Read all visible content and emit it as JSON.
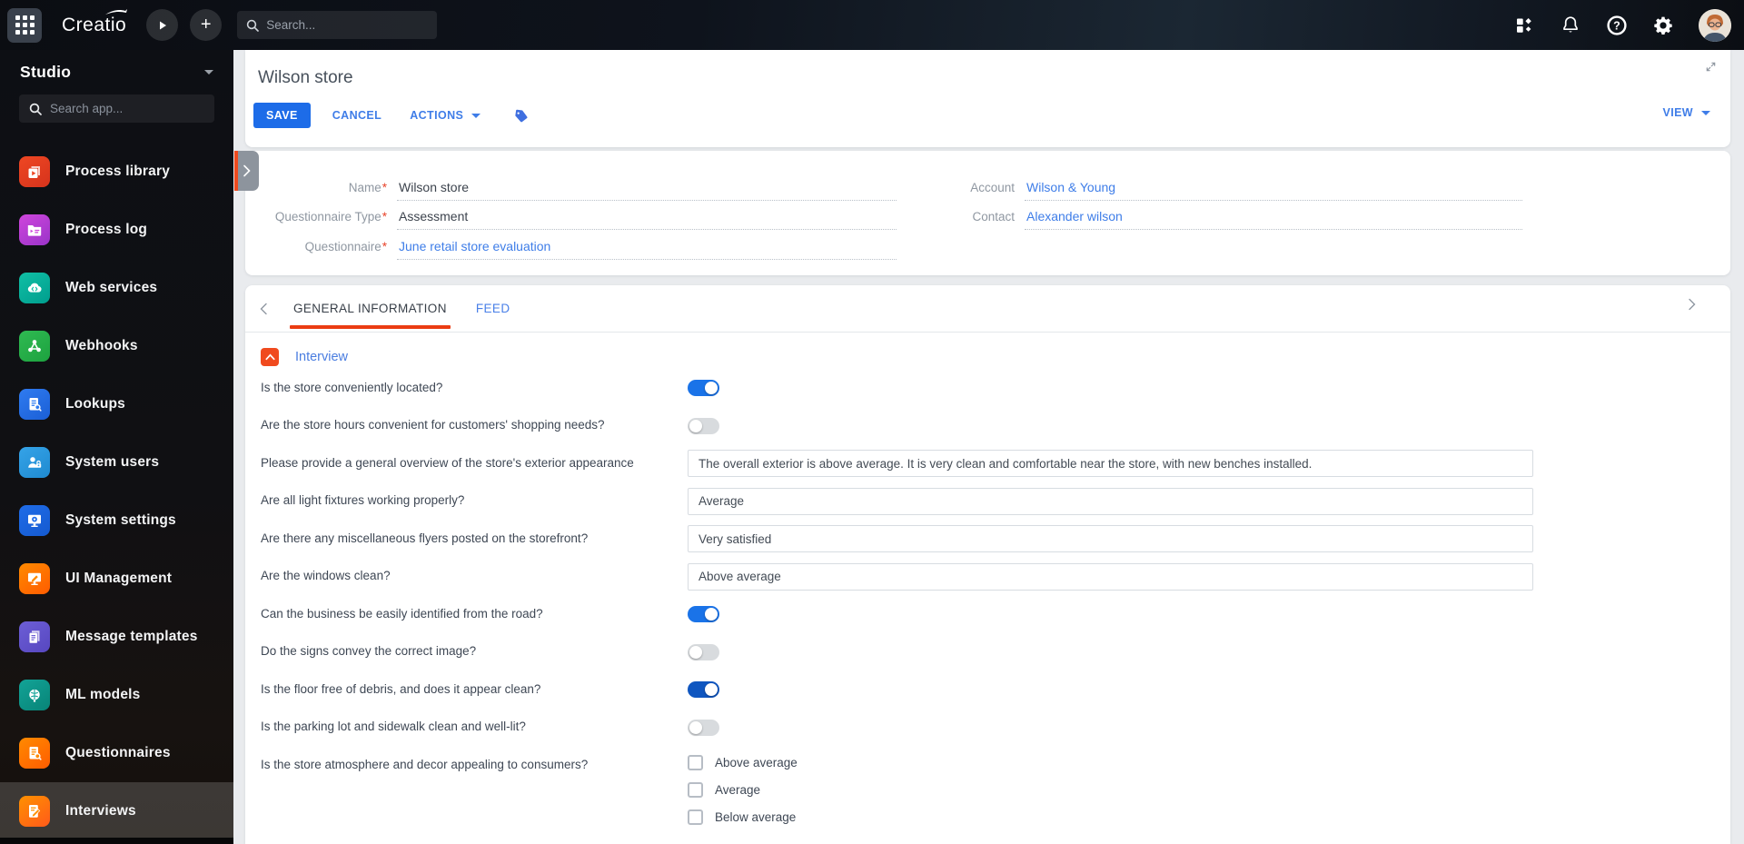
{
  "topbar": {
    "logo": "Creatio",
    "search_placeholder": "Search...",
    "right_icons": [
      "apps",
      "notifications",
      "help",
      "settings",
      "avatar"
    ]
  },
  "sidebar": {
    "workspace": "Studio",
    "search_placeholder": "Search app...",
    "items": [
      {
        "label": "Process library",
        "icon": "process-library",
        "tile": "#ee4723",
        "tile2": "#d6331c",
        "selected": false
      },
      {
        "label": "Process log",
        "icon": "process-log",
        "tile": "#cf46dc",
        "tile2": "#9a34c9",
        "selected": false
      },
      {
        "label": "Web services",
        "icon": "web-services",
        "tile": "#10bfa5",
        "tile2": "#009e8e",
        "selected": false
      },
      {
        "label": "Webhooks",
        "icon": "webhooks",
        "tile": "#2fba52",
        "tile2": "#1da23f",
        "selected": false
      },
      {
        "label": "Lookups",
        "icon": "lookups",
        "tile": "#2f7bf0",
        "tile2": "#1b5fd6",
        "selected": false
      },
      {
        "label": "System users",
        "icon": "system-users",
        "tile": "#35a3e8",
        "tile2": "#1f8ad0",
        "selected": false
      },
      {
        "label": "System settings",
        "icon": "system-settings",
        "tile": "#1f6ce8",
        "tile2": "#155ad0",
        "selected": false
      },
      {
        "label": "UI Management",
        "icon": "ui-management",
        "tile": "#ff8a00",
        "tile2": "#ff5c00",
        "selected": false
      },
      {
        "label": "Message templates",
        "icon": "message-templates",
        "tile": "#6c5ed6",
        "tile2": "#5747c0",
        "selected": false
      },
      {
        "label": "ML models",
        "icon": "ml-models",
        "tile": "#12a397",
        "tile2": "#088477",
        "selected": false
      },
      {
        "label": "Questionnaires",
        "icon": "questionnaires",
        "tile": "#ff8a00",
        "tile2": "#ff5c00",
        "selected": false
      },
      {
        "label": "Interviews",
        "icon": "interviews",
        "tile": "#ff9100",
        "tile2": "#ff5a1a",
        "selected": true
      }
    ]
  },
  "record": {
    "title": "Wilson store",
    "save_label": "SAVE",
    "cancel_label": "CANCEL",
    "actions_label": "ACTIONS",
    "view_label": "VIEW",
    "required_marker": "*"
  },
  "profile": {
    "left": [
      {
        "label": "Name",
        "required": true,
        "value": "Wilson store",
        "link": false
      },
      {
        "label": "Questionnaire Type",
        "required": true,
        "value": "Assessment",
        "link": false
      },
      {
        "label": "Questionnaire",
        "required": true,
        "value": "June retail store evaluation",
        "link": true
      }
    ],
    "right": [
      {
        "label": "Account",
        "required": false,
        "value": "Wilson & Young",
        "link": true
      },
      {
        "label": "Contact",
        "required": false,
        "value": "Alexander wilson",
        "link": true
      }
    ]
  },
  "tabs": {
    "items": [
      "GENERAL INFORMATION",
      "FEED"
    ],
    "active_index": 0
  },
  "section": {
    "title": "Interview"
  },
  "questions": [
    {
      "text": "Is the store conveniently located?",
      "type": "toggle",
      "on": true,
      "focused": false
    },
    {
      "text": "Are the store hours convenient for customers' shopping needs?",
      "type": "toggle",
      "on": false,
      "focused": false
    },
    {
      "text": "Please provide a general overview of the store's exterior appearance",
      "type": "text",
      "value": "The overall exterior is above average. It is very clean and comfortable near the store, with new benches installed."
    },
    {
      "text": "Are all light fixtures working properly?",
      "type": "text",
      "value": "Average"
    },
    {
      "text": "Are there any miscellaneous flyers posted on the storefront?",
      "type": "text",
      "value": "Very satisfied"
    },
    {
      "text": "Are the windows clean?",
      "type": "text",
      "value": "Above average"
    },
    {
      "text": "Can the business be easily identified from the road?",
      "type": "toggle",
      "on": true,
      "focused": false
    },
    {
      "text": "Do the signs convey the correct image?",
      "type": "toggle",
      "on": false,
      "focused": false
    },
    {
      "text": "Is the floor free of debris, and does it appear clean?",
      "type": "toggle",
      "on": true,
      "focused": true
    },
    {
      "text": "Is the parking lot and sidewalk clean and well-lit?",
      "type": "toggle",
      "on": false,
      "focused": false
    },
    {
      "text": "Is the store atmosphere and decor appealing to consumers?",
      "type": "checkbox-group",
      "options": [
        {
          "label": "Above average",
          "checked": false
        },
        {
          "label": "Average",
          "checked": false
        },
        {
          "label": "Below average",
          "checked": false
        }
      ]
    }
  ],
  "colors": {
    "primary_button": "#1d6ce8",
    "link": "#3e7de8",
    "toggle_on": "#1a73e8",
    "toggle_on_focused": "#0f56c0",
    "tab_underline": "#eb3c12",
    "section_icon": "#f04a1e",
    "required": "#e8432a",
    "topbar_bg": "#10151d",
    "sidebar_bg": "#0e0f13"
  }
}
